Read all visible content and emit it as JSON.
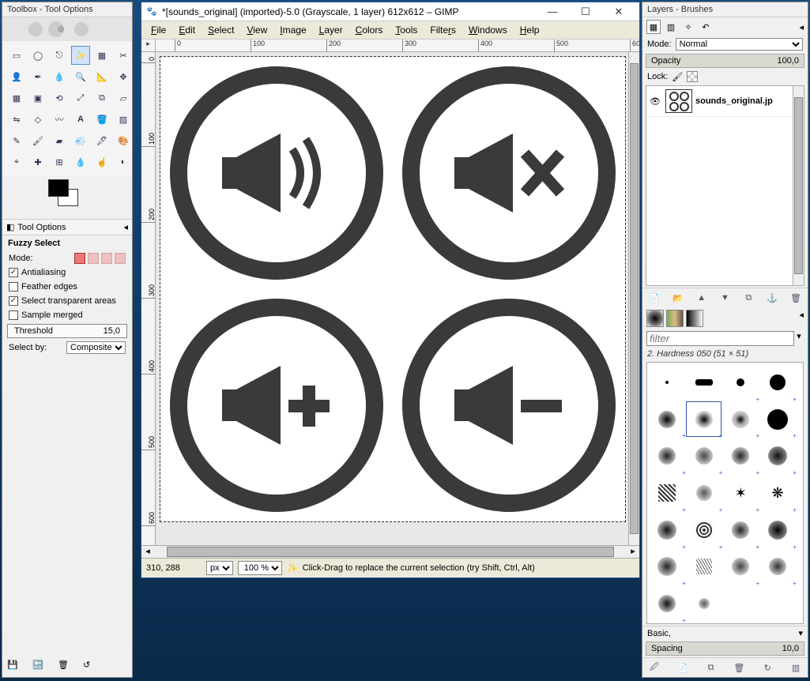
{
  "toolbox": {
    "title": "Toolbox - Tool Options",
    "options_label": "Tool Options",
    "current_tool": "Fuzzy Select",
    "mode_label": "Mode:",
    "antialiasing": "Antialiasing",
    "feather": "Feather edges",
    "transparent": "Select transparent areas",
    "sample_merged": "Sample merged",
    "threshold_label": "Threshold",
    "threshold_value": "15,0",
    "selectby_label": "Select by:",
    "selectby_value": "Composite"
  },
  "main": {
    "title": "*[sounds_original] (imported)-5.0 (Grayscale, 1 layer) 612x612 – GIMP",
    "menus": [
      "File",
      "Edit",
      "Select",
      "View",
      "Image",
      "Layer",
      "Colors",
      "Tools",
      "Filters",
      "Windows",
      "Help"
    ],
    "ruler_ticks": [
      "0",
      "100",
      "200",
      "300",
      "400",
      "500",
      "600"
    ],
    "status": {
      "coord": "310, 288",
      "unit": "px",
      "zoom": "100 %",
      "hint": "Click-Drag to replace the current selection (try Shift, Ctrl, Alt)"
    }
  },
  "right": {
    "title": "Layers - Brushes",
    "mode_label": "Mode:",
    "mode_value": "Normal",
    "opacity_label": "Opacity",
    "opacity_value": "100,0",
    "lock_label": "Lock:",
    "layer_name": "sounds_original.jp",
    "filter_placeholder": "filter",
    "brush_label": "2. Hardness 050 (51 × 51)",
    "brush_set": "Basic,",
    "spacing_label": "Spacing",
    "spacing_value": "10,0"
  }
}
